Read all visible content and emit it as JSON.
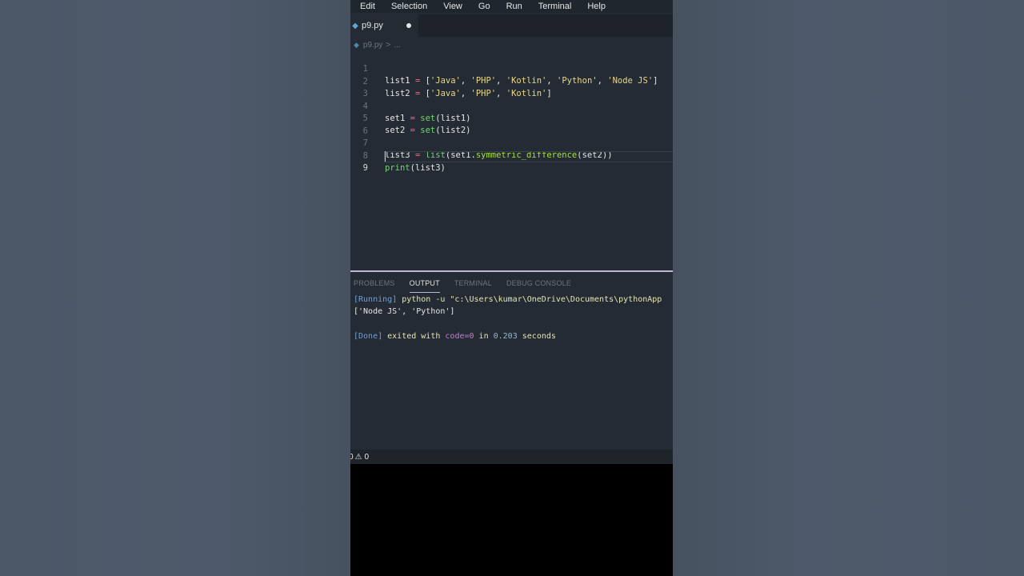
{
  "menu": [
    "Edit",
    "Selection",
    "View",
    "Go",
    "Run",
    "Terminal",
    "Help"
  ],
  "tab": {
    "label": "p9.py",
    "icon": "python-file-icon"
  },
  "breadcrumb": {
    "file": "p9.py",
    "separator": ">",
    "rest": "..."
  },
  "editor": {
    "line_numbers": [
      "1",
      "2",
      "3",
      "4",
      "5",
      "6",
      "7",
      "8",
      "9"
    ],
    "lines": [
      [
        "list1 ",
        "= ",
        "[",
        "'Java'",
        ", ",
        "'PHP'",
        ", ",
        "'Kotlin'",
        ", ",
        "'Python'",
        ", ",
        "'Node JS'",
        "]"
      ],
      [
        "list2 ",
        "= ",
        "[",
        "'Java'",
        ", ",
        "'PHP'",
        ", ",
        "'Kotlin'",
        "]"
      ],
      [],
      [
        "set1 ",
        "= ",
        "set",
        "(list1)"
      ],
      [
        "set2 ",
        "= ",
        "set",
        "(list2)"
      ],
      [],
      [
        "list3 ",
        "= ",
        "list",
        "(set1.",
        "symmetric_difference",
        "(set2))"
      ],
      [
        "print",
        "(list3)"
      ],
      []
    ]
  },
  "panel": {
    "tabs": [
      "PROBLEMS",
      "OUTPUT",
      "TERMINAL",
      "DEBUG CONSOLE"
    ],
    "active_tab": "OUTPUT",
    "output": {
      "running_tag": "[Running]",
      "running_cmd": " python -u \"c:\\Users\\kumar\\OneDrive\\Documents\\pythonApp",
      "result": "['Node JS', 'Python']",
      "done_tag": "[Done]",
      "done_text1": " exited with ",
      "done_code": "code=0",
      "done_text2": " in ",
      "done_time": "0.203",
      "done_text3": " seconds"
    }
  },
  "status": {
    "errors": "0",
    "warning_icon": "⚠",
    "warnings": "0"
  },
  "colors": {
    "accent_border": "#bdb6d6",
    "editor_bg": "#252b34",
    "string": "#e6d98a",
    "operator": "#e66d8c",
    "function": "#72d572"
  }
}
